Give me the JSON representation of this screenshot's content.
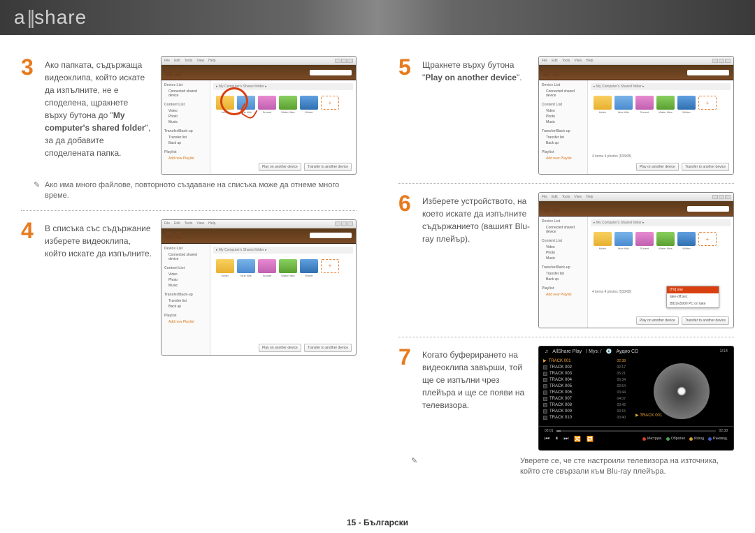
{
  "logo": "allshare",
  "footer": "15  - Български",
  "steps": {
    "s3": {
      "num": "3",
      "text_pre": "Ако папката, съдържаща видеоклипа, който искате да изпълните, не е споделена, щракнете върху бутона до \"",
      "bold": "My computer's shared folder",
      "text_post": "\", за да добавите споделената папка."
    },
    "s3_note": "Ако има много файлове, повторното създаване на списъка може да отнеме много време.",
    "s4": {
      "num": "4",
      "text": "В списъка със съдържание изберете видеоклипа, който искате да изпълните."
    },
    "s5": {
      "num": "5",
      "text_pre": "Щракнете върху бутона \"",
      "bold": "Play on another device",
      "text_post": "\"."
    },
    "s6": {
      "num": "6",
      "text": "Изберете устройството, на което искате да изпълните съдържанието (вашият Blu-ray плейър)."
    },
    "s7": {
      "num": "7",
      "text": "Когато буферирането на видеоклипа завърши, той ще се изпълни чрез плейъра и ще се появи на телевизора."
    },
    "s7_note": "Уверете се, че сте настроили телевизора на източника, който сте свързали към Blu-ray плейъра."
  },
  "window": {
    "menu": [
      "File",
      "Edit",
      "Tools",
      "View",
      "Help"
    ],
    "crumb": "▸ My Computer's Shared folder ▸",
    "side": {
      "device_list": "Device List",
      "device_item": "Connected shared device",
      "content_list": "Content List",
      "items": [
        "Video",
        "Photo",
        "Music"
      ],
      "transfer": "Transfer/Back-up",
      "titems": [
        "Transfer list",
        "Back up"
      ],
      "playlist": "Playlist",
      "plink": "Add new Playlist"
    },
    "thumbs": [
      "folder",
      "blue hills",
      "Sunset",
      "Water lilies",
      "Winter"
    ],
    "add": "+",
    "btn_play": "Play on another device",
    "btn_transfer": "Transfer to another device",
    "selected_info": "4 items  4 photos  (533KB)"
  },
  "device_popup": {
    "header": "[TV] one",
    "items": [
      "lake-off.sec",
      "[BD] E5900 PC on lake"
    ]
  },
  "player": {
    "title": "AllShare Play",
    "path": "/ Муз. /",
    "album": "Аудио CD",
    "count": "1/14",
    "tracks": [
      {
        "n": "TRACK 001",
        "t": "02:38"
      },
      {
        "n": "TRACK 002",
        "t": "02:17"
      },
      {
        "n": "TRACK 003",
        "t": "05:21"
      },
      {
        "n": "TRACK 004",
        "t": "05:34"
      },
      {
        "n": "TRACK 005",
        "t": "02:54"
      },
      {
        "n": "TRACK 006",
        "t": "03:44"
      },
      {
        "n": "TRACK 007",
        "t": "04:07"
      },
      {
        "n": "TRACK 008",
        "t": "03:42"
      },
      {
        "n": "TRACK 009",
        "t": "03:15"
      },
      {
        "n": "TRACK 010",
        "t": "03:40"
      }
    ],
    "now": "TRACK 001",
    "time_cur": "00:01",
    "time_tot": "02:38",
    "legend": [
      "Инструм.",
      "Обратно",
      "Изход",
      "Ръковод."
    ]
  }
}
